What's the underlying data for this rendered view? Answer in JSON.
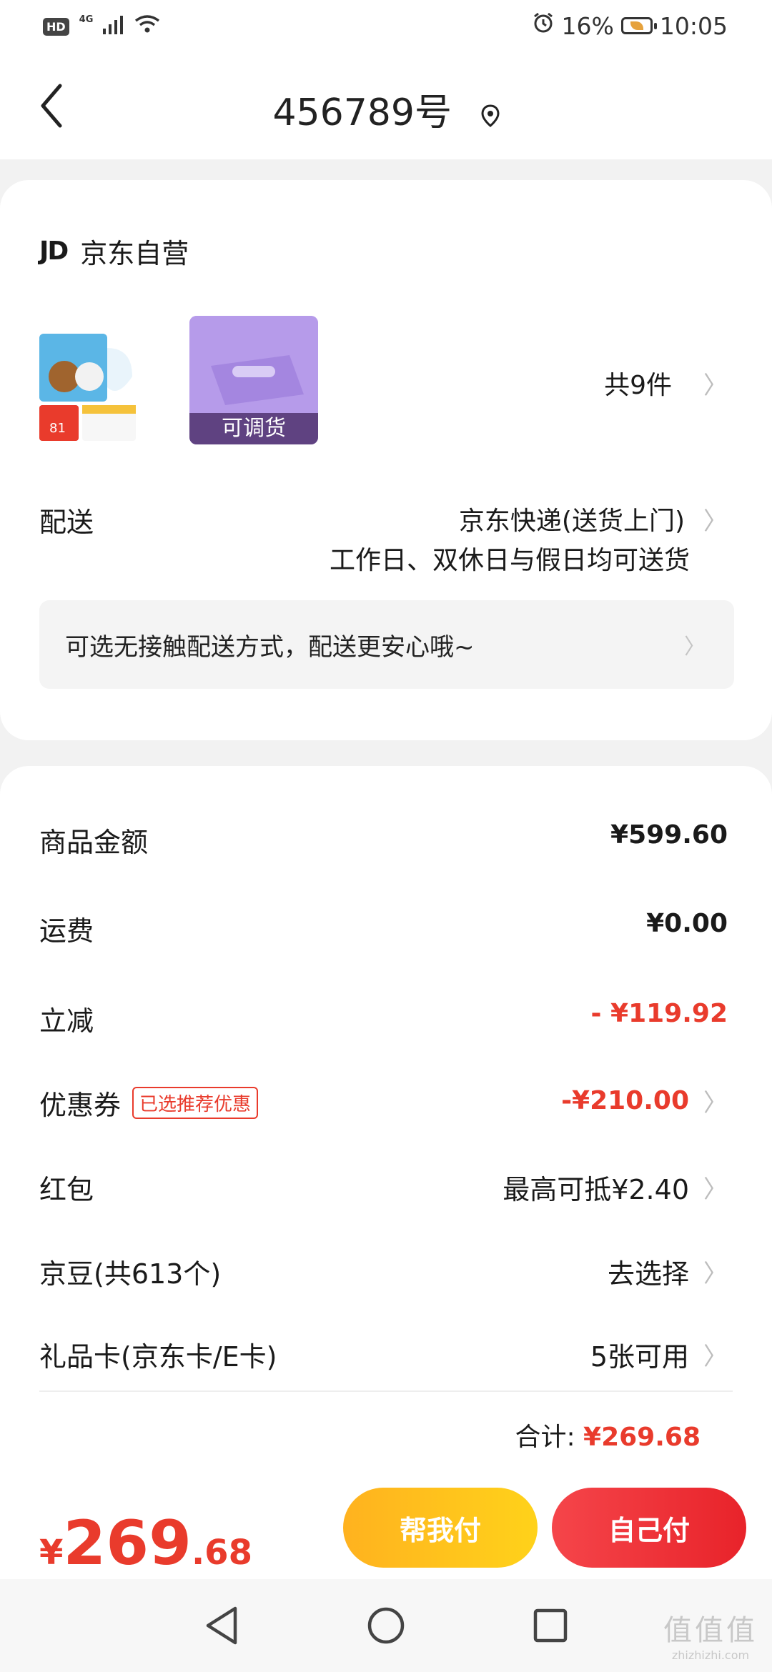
{
  "status_bar": {
    "hd": "HD",
    "network": "4G",
    "battery": "16%",
    "time": "10:05"
  },
  "header": {
    "title": "456789号"
  },
  "shop": {
    "logo": "JD",
    "name": "京东自营"
  },
  "products": {
    "adjustable_label": "可调货",
    "count": "共9件"
  },
  "delivery": {
    "label": "配送",
    "method": "京东快递(送货上门)",
    "note": "工作日、双休日与假日均可送货",
    "contactless": "可选无接触配送方式，配送更安心哦~"
  },
  "fees": {
    "goods_label": "商品金额",
    "goods_value": "¥599.60",
    "shipping_label": "运费",
    "shipping_value": "¥0.00",
    "discount_label": "立减",
    "discount_value": "- ¥119.92",
    "coupon_label": "优惠券",
    "coupon_tag": "已选推荐优惠",
    "coupon_value": "-¥210.00",
    "redpacket_label": "红包",
    "redpacket_value": "最高可抵¥2.40",
    "jingdou_label": "京豆(共613个)",
    "jingdou_value": "去选择",
    "giftcard_label": "礼品卡(京东卡/E卡)",
    "giftcard_value": "5张可用",
    "total_label": "合计:",
    "total_value": "¥269.68"
  },
  "checkout": {
    "currency": "¥",
    "price_int": "269",
    "price_dec": ".68",
    "help_pay": "帮我付",
    "self_pay": "自己付"
  },
  "watermark": {
    "main": "值值值",
    "sub": "zhizhizhi.com"
  },
  "colors": {
    "accent_red": "#e93b2c",
    "help_pay_yellow": "#ffc21d",
    "self_pay_red": "#ef3137"
  }
}
